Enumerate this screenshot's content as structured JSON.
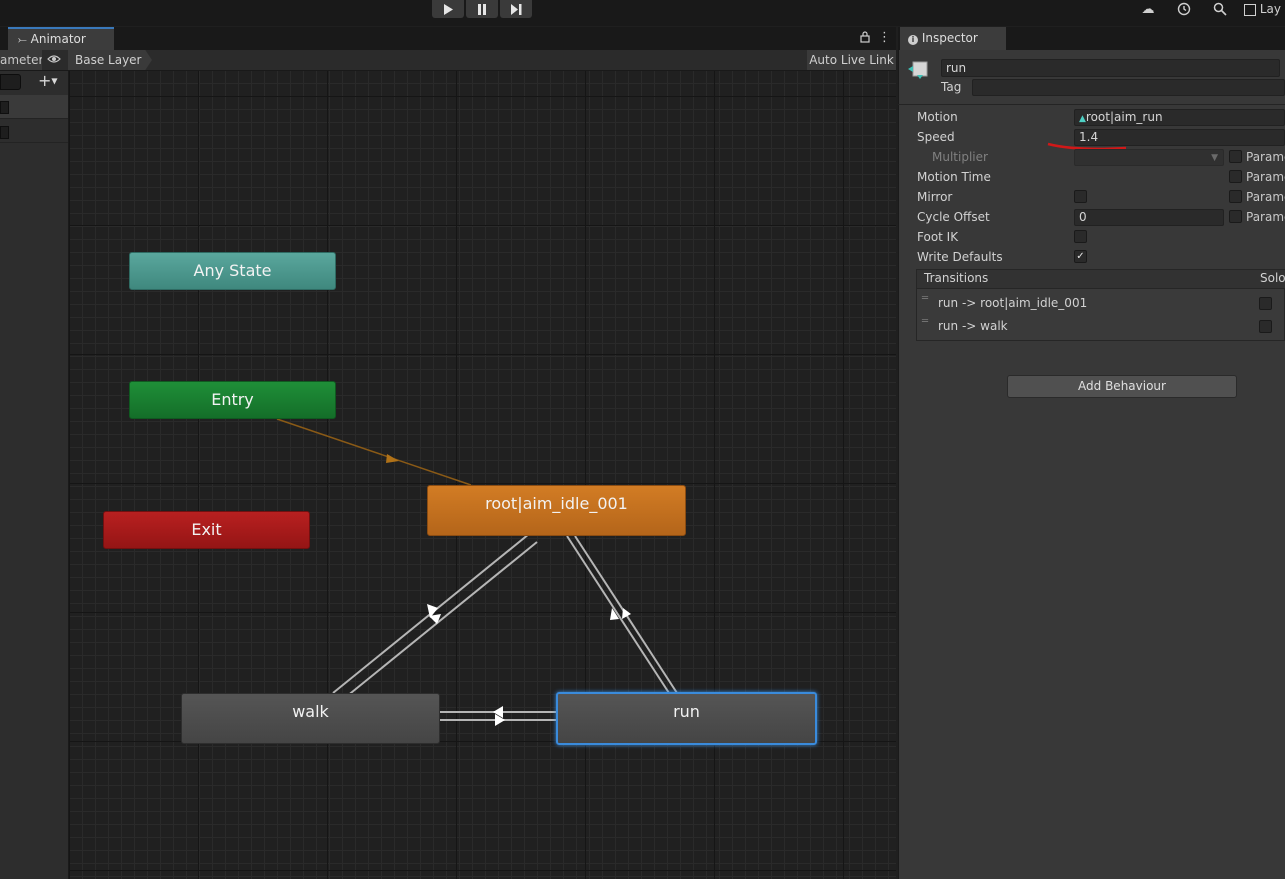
{
  "toolbar": {
    "play_icon": "play-icon",
    "pause_icon": "pause-icon",
    "step_icon": "step-icon",
    "right_label": "Lay"
  },
  "animator": {
    "tab_label": "Animator",
    "params_tab_label": "ameters",
    "breadcrumb": "Base Layer",
    "auto_live_link": "Auto Live Link",
    "nodes": {
      "any_state": "Any State",
      "entry": "Entry",
      "exit": "Exit",
      "idle": "root|aim_idle_001",
      "walk": "walk",
      "run": "run"
    },
    "colors": {
      "any_state": "#4a968c",
      "entry": "#177a2e",
      "exit": "#a61a1a",
      "default_state": "#c06e20",
      "state": "#4b4b4b",
      "selected_outline": "#3a8bdc"
    }
  },
  "inspector": {
    "tab_label": "Inspector",
    "state_name": "run",
    "tag_label": "Tag",
    "tag_value": "",
    "motion_label": "Motion",
    "motion_value": "root|aim_run",
    "speed_label": "Speed",
    "speed_value": "1.4",
    "multiplier_label": "Multiplier",
    "motion_time_label": "Motion Time",
    "mirror_label": "Mirror",
    "cycle_offset_label": "Cycle Offset",
    "cycle_offset_value": "0",
    "foot_ik_label": "Foot IK",
    "write_defaults_label": "Write Defaults",
    "parameter_label": "Parame",
    "transitions_header": "Transitions",
    "solo_header": "Solo",
    "transitions": [
      {
        "label": "run -> root|aim_idle_001"
      },
      {
        "label": "run -> walk"
      }
    ],
    "add_behaviour": "Add Behaviour"
  }
}
